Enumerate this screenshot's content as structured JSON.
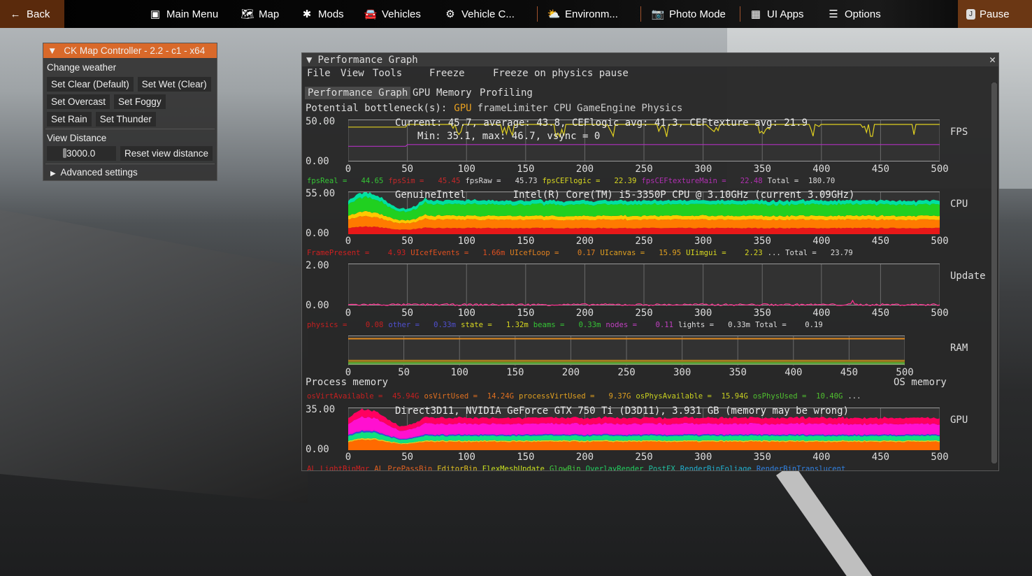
{
  "topbar": {
    "back": "Back",
    "items": [
      {
        "label": "Main Menu",
        "icon": "main-menu-icon",
        "glyph": "▣"
      },
      {
        "label": "Map",
        "icon": "map-icon",
        "glyph": "🗺"
      },
      {
        "label": "Mods",
        "icon": "puzzle-icon",
        "glyph": "✱"
      },
      {
        "label": "Vehicles",
        "icon": "car-icon",
        "glyph": "🚘"
      },
      {
        "label": "Vehicle C...",
        "icon": "engine-icon",
        "glyph": "⚙"
      },
      {
        "label": "Environm...",
        "icon": "weather-icon",
        "glyph": "⛅"
      },
      {
        "label": "Photo Mode",
        "icon": "camera-icon",
        "glyph": "📷"
      },
      {
        "label": "UI Apps",
        "icon": "ui-apps-icon",
        "glyph": "▦"
      },
      {
        "label": "Options",
        "icon": "sliders-icon",
        "glyph": "☰"
      }
    ],
    "pause": "Pause",
    "pause_key": "J"
  },
  "ck": {
    "title": "CK Map Controller - 2.2 - c1 - x64",
    "change_weather": "Change weather",
    "buttons": [
      [
        "Set Clear (Default)",
        "Set Wet (Clear)"
      ],
      [
        "Set Overcast",
        "Set Foggy"
      ],
      [
        "Set Rain",
        "Set Thunder"
      ]
    ],
    "view_distance": "View Distance",
    "view_distance_value": "3000.0",
    "reset": "Reset view distance",
    "advanced": "Advanced settings"
  },
  "perf": {
    "title": "Performance Graph",
    "menu": [
      "File",
      "View",
      "Tools",
      "Freeze",
      "Freeze on physics pause"
    ],
    "tabs": [
      "Performance Graph",
      "GPU",
      "Memory",
      "Profiling"
    ],
    "active_tab": "Performance Graph",
    "bottleneck_label": "Potential bottleneck(s):",
    "bottlenecks": [
      {
        "t": "GPU",
        "c": "#e8a020"
      },
      {
        "t": "frameLimiter",
        "c": "#cccccc"
      },
      {
        "t": "CPU",
        "c": "#cccccc"
      },
      {
        "t": "GameEngine",
        "c": "#cccccc"
      },
      {
        "t": "Physics",
        "c": "#cccccc"
      }
    ],
    "xticks": [
      "0",
      "50",
      "100",
      "150",
      "200",
      "250",
      "300",
      "350",
      "400",
      "450",
      "500"
    ],
    "sections": [
      {
        "key": "fps",
        "label": "FPS",
        "ymax": "50.00",
        "ymin": "0.00",
        "scale": 50,
        "overlay": [
          "Current: 45.7, average: 43.8, CEFlogic avg: 41.3, CEFtexture avg: 21.9",
          "Min: 35.1, max: 46.7, vsync = 0"
        ],
        "lines": [
          {
            "v": 45,
            "c": "#e0d020",
            "dips": true
          },
          {
            "v": 21,
            "c": "#b030c0"
          }
        ],
        "legend": [
          {
            "n": "fpsReal =",
            "v": "44.65",
            "c": "#35c435"
          },
          {
            "n": "fpsSim =",
            "v": "45.45",
            "c": "#c42828"
          },
          {
            "n": "fpsRaw =",
            "v": "45.73",
            "c": "#dddddd"
          },
          {
            "n": "fpsCEFlogic =",
            "v": "22.39",
            "c": "#d8d820"
          },
          {
            "n": "fpsCEFtextureMain =",
            "v": "22.48",
            "c": "#b030b0"
          },
          {
            "n": "Total =",
            "v": "180.70",
            "c": "#dddddd"
          }
        ]
      },
      {
        "key": "cpu",
        "label": "CPU",
        "ymax": "55.00",
        "ymin": "0.00",
        "scale": 55,
        "overlay": [
          "GenuineIntel        Intel(R) Core(TM) i5-3350P CPU @ 3.10GHz (current 3.09GHz)"
        ],
        "bands": [
          {
            "v": 8,
            "c": "#e81818"
          },
          {
            "v": 11,
            "c": "#ff7a00"
          },
          {
            "v": 5,
            "c": "#ffc800"
          },
          {
            "v": 15,
            "c": "#20d020"
          },
          {
            "v": 5,
            "c": "#00e0a0"
          }
        ],
        "legend": [
          {
            "n": "FramePresent =",
            "v": "4.93",
            "c": "#d02020"
          },
          {
            "n": "UIcefEvents =",
            "v": "1.66m",
            "c": "#e05020"
          },
          {
            "n": "UIcefLoop =",
            "v": "0.17",
            "c": "#e08020"
          },
          {
            "n": "UIcanvas =",
            "v": "15.95",
            "c": "#e0a020"
          },
          {
            "n": "UIimgui =",
            "v": "2.23",
            "c": "#d8d820"
          },
          {
            "n": "... Total =",
            "v": "23.79",
            "c": "#dddddd"
          }
        ]
      },
      {
        "key": "update",
        "label": "Update",
        "ymax": "2.00",
        "ymin": "0.00",
        "scale": 2,
        "lines": [
          {
            "v": 0.08,
            "c": "#ff3090",
            "noise": true
          }
        ],
        "legend": [
          {
            "n": "physics =",
            "v": "0.08",
            "c": "#c42020"
          },
          {
            "n": "other =",
            "v": "0.33m",
            "c": "#5050d0"
          },
          {
            "n": "state =",
            "v": "1.32m",
            "c": "#d8d820"
          },
          {
            "n": "beams =",
            "v": "0.33m",
            "c": "#35c435"
          },
          {
            "n": "nodes =",
            "v": "0.11",
            "c": "#c040c0"
          },
          {
            "n": "lights =",
            "v": "0.33m",
            "c": "#dddddd"
          },
          {
            "n": "Total =",
            "v": "0.19",
            "c": "#dddddd"
          }
        ]
      },
      {
        "key": "ram",
        "label": "RAM",
        "left_caption": "Process memory",
        "right_caption": "OS memory",
        "lines": [
          {
            "f": 0.96,
            "c": "#e08a20"
          },
          {
            "f": 0.14,
            "c": "#b08020"
          },
          {
            "f": 0.09,
            "c": "#8a7a20"
          },
          {
            "f": 0.04,
            "c": "#40b030"
          },
          {
            "f": 0.0,
            "c": "#7a9a60"
          }
        ],
        "legend": [
          {
            "n": "osVirtAvailable =",
            "v": "45.94G",
            "c": "#c42020"
          },
          {
            "n": "osVirtUsed =",
            "v": "14.24G",
            "c": "#e07020"
          },
          {
            "n": "processVirtUsed =",
            "v": "9.37G",
            "c": "#e0a020"
          },
          {
            "n": "osPhysAvailable =",
            "v": "15.94G",
            "c": "#c8d020"
          },
          {
            "n": "osPhysUsed =",
            "v": "10.40G",
            "c": "#50c030"
          },
          {
            "n": "...",
            "v": "",
            "c": "#dddddd"
          }
        ]
      },
      {
        "key": "gpu",
        "label": "GPU",
        "ymax": "35.00",
        "ymin": "0.00",
        "scale": 35,
        "overlay": [
          "Direct3D11, NVIDIA GeForce GTX 750 Ti (D3D11), 3.931 GB (memory may be wrong)"
        ],
        "bands": [
          {
            "v": 7,
            "c": "#ff6a00"
          },
          {
            "v": 1,
            "c": "#e8d020"
          },
          {
            "v": 4,
            "c": "#10e080"
          },
          {
            "v": 1,
            "c": "#3050e0"
          },
          {
            "v": 9,
            "c": "#ff10d0"
          },
          {
            "v": 5,
            "c": "#ff0060"
          }
        ],
        "legend": [
          {
            "n": "AL_LightBinMgr",
            "v": "",
            "c": "#d02020"
          },
          {
            "n": "AL_PrePassBin",
            "v": "",
            "c": "#e06020"
          },
          {
            "n": "EditorBin",
            "v": "",
            "c": "#e0c020"
          },
          {
            "n": "FlexMeshUpdate",
            "v": "",
            "c": "#c8e020"
          },
          {
            "n": "GlowBin",
            "v": "",
            "c": "#40d040"
          },
          {
            "n": "OverlayRender",
            "v": "",
            "c": "#20d060"
          },
          {
            "n": "PostFX",
            "v": "",
            "c": "#20c0a0"
          },
          {
            "n": "RenderBinFoliage",
            "v": "",
            "c": "#20b0d0"
          },
          {
            "n": "RenderBinTranslucent",
            "v": "",
            "c": "#3080e0"
          }
        ]
      }
    ]
  }
}
